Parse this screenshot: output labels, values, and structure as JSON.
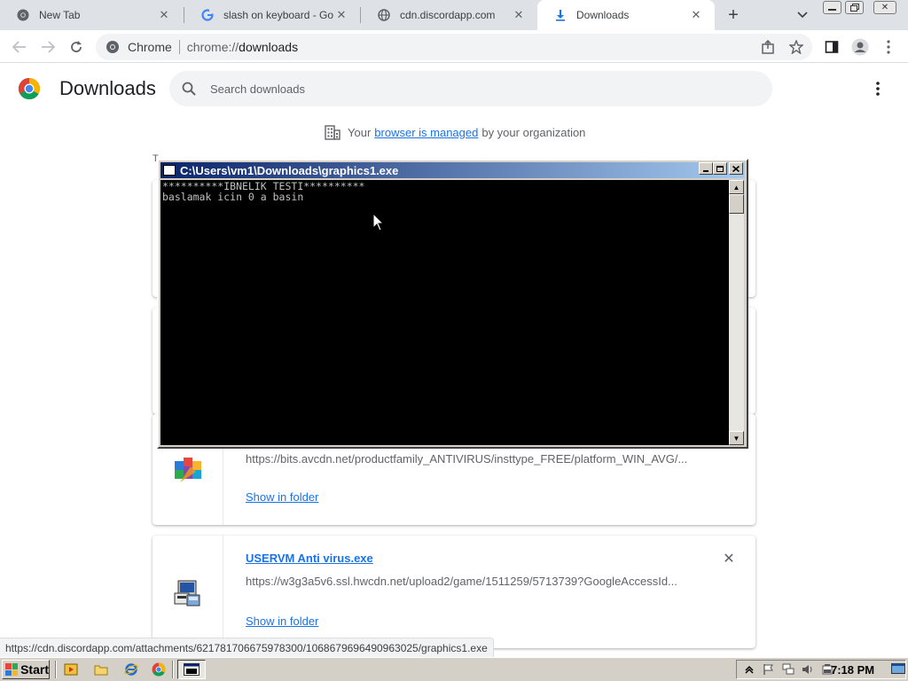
{
  "tabs": [
    {
      "title": "New Tab",
      "icon": "chrome-icon",
      "active": false
    },
    {
      "title": "slash on keyboard - Goog",
      "icon": "google-g-icon",
      "active": false
    },
    {
      "title": "cdn.discordapp.com",
      "icon": "globe-icon",
      "active": false
    },
    {
      "title": "Downloads",
      "icon": "download-icon",
      "active": true
    }
  ],
  "omnibox": {
    "site_label": "Chrome",
    "url_scheme": "chrome://",
    "url_host": "downloads"
  },
  "page": {
    "title": "Downloads",
    "search_placeholder": "Search downloads",
    "managed_prefix": "Your",
    "managed_link": "browser is managed",
    "managed_suffix": "by your organization",
    "partial_text": "T"
  },
  "downloads": [
    {
      "url": "https://bits.avcdn.net/productfamily_ANTIVIRUS/insttype_FREE/platform_WIN_AVG/...",
      "show_in_folder": "Show in folder",
      "icon": "avg-installer-icon"
    },
    {
      "filename": "USERVM Anti virus.exe",
      "url": "https://w3g3a5v6.ssl.hwcdn.net/upload2/game/1511259/5713739?GoogleAccessId...",
      "show_in_folder": "Show in folder",
      "icon": "setup-installer-icon"
    }
  ],
  "console": {
    "title": "C:\\Users\\vm1\\Downloads\\graphics1.exe",
    "line1": "**********IBNELIK TESTI**********",
    "line2": "baslamak icin 0 a basin"
  },
  "status_bubble": "https://cdn.discordapp.com/attachments/621781706675978300/1068679696490963025/graphics1.exe",
  "taskbar": {
    "start_label": "Start",
    "clock": "7:18 PM"
  },
  "colors": {
    "link_blue": "#1a73e8",
    "console_title_start": "#0a246a",
    "console_title_end": "#a6caf0"
  }
}
